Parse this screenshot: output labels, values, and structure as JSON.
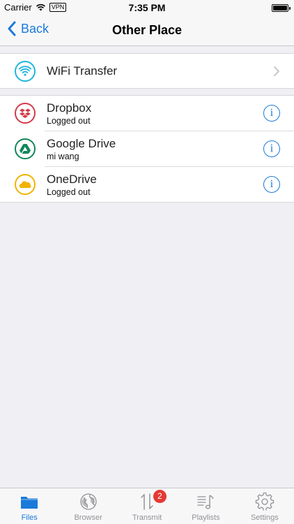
{
  "status_bar": {
    "carrier": "Carrier",
    "vpn": "VPN",
    "time": "7:35 PM"
  },
  "nav": {
    "back_label": "Back",
    "title": "Other Place"
  },
  "wifi_row": {
    "title": "WiFi Transfer",
    "icon": "wifi-icon",
    "color": "#1fb6dd"
  },
  "cloud_rows": [
    {
      "title": "Dropbox",
      "subtitle": "Logged out",
      "icon": "dropbox-icon",
      "color": "#d23c4a"
    },
    {
      "title": "Google Drive",
      "subtitle": "mi wang",
      "icon": "google-drive-icon",
      "color": "#12875b"
    },
    {
      "title": "OneDrive",
      "subtitle": "Logged out",
      "icon": "onedrive-icon",
      "color": "#f0b400"
    }
  ],
  "tabs": [
    {
      "label": "Files",
      "icon": "folder-icon",
      "active": true
    },
    {
      "label": "Browser",
      "icon": "globe-icon",
      "active": false
    },
    {
      "label": "Transmit",
      "icon": "transfer-icon",
      "active": false,
      "badge": "2"
    },
    {
      "label": "Playlists",
      "icon": "playlist-icon",
      "active": false
    },
    {
      "label": "Settings",
      "icon": "gear-icon",
      "active": false
    }
  ],
  "colors": {
    "accent": "#1a7ad9",
    "background": "#efeff4",
    "badge": "#e53935"
  }
}
